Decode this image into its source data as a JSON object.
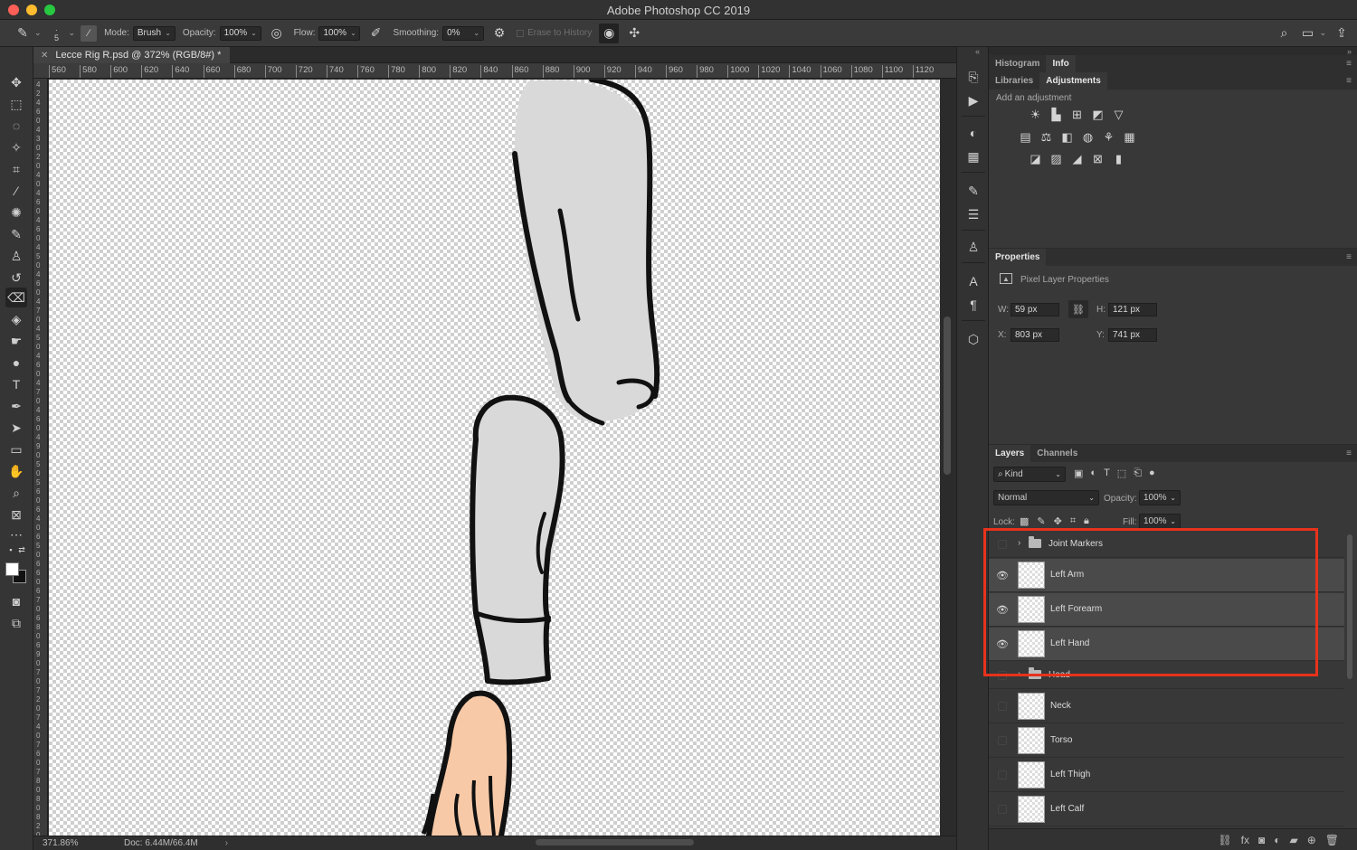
{
  "window": {
    "title": "Adobe Photoshop CC 2019"
  },
  "colors": {
    "close": "#fe5f57",
    "minimize": "#febc2e",
    "zoom": "#28c840",
    "highlight": "#e8321c",
    "sleeve": "#d9d9d9",
    "skin": "#f7c9a7"
  },
  "options": {
    "brush_size": "5",
    "mode_label": "Mode:",
    "mode_value": "Brush",
    "opacity_label": "Opacity:",
    "opacity_value": "100%",
    "flow_label": "Flow:",
    "flow_value": "100%",
    "smoothing_label": "Smoothing:",
    "smoothing_value": "0%",
    "erase_history": "Erase to History"
  },
  "document": {
    "tab_title": "Lecce Rig R.psd @ 372% (RGB/8#) *"
  },
  "ruler": {
    "h_ticks": [
      "560",
      "580",
      "600",
      "620",
      "640",
      "660",
      "680",
      "700",
      "720",
      "740",
      "760",
      "780",
      "800",
      "820",
      "840",
      "860",
      "880",
      "900",
      "920",
      "940",
      "960",
      "980",
      "1000",
      "1020",
      "1040",
      "1060",
      "1080",
      "1100",
      "1120"
    ]
  },
  "status": {
    "zoom": "371.86%",
    "doc": "Doc: 6.44M/66.4M"
  },
  "panels": {
    "histogram_tab": "Histogram",
    "info_tab": "Info",
    "libraries_tab": "Libraries",
    "adjustments_tab": "Adjustments",
    "add_adjustment": "Add an adjustment",
    "properties_tab": "Properties",
    "pixel_layer_props": "Pixel Layer Properties",
    "w_label": "W:",
    "w_value": "59 px",
    "h_label": "H:",
    "h_value": "121 px",
    "x_label": "X:",
    "x_value": "803 px",
    "y_label": "Y:",
    "y_value": "741 px"
  },
  "layers_panel": {
    "layers_tab": "Layers",
    "channels_tab": "Channels",
    "kind_label": "Kind",
    "blend_mode": "Normal",
    "opacity_label": "Opacity:",
    "opacity_value": "100%",
    "lock_label": "Lock:",
    "fill_label": "Fill:",
    "fill_value": "100%",
    "layers": [
      {
        "name": "Joint Markers",
        "type": "group",
        "visible": false,
        "selected": false
      },
      {
        "name": "Left Arm",
        "type": "pixel",
        "visible": true,
        "selected": true
      },
      {
        "name": "Left Forearm",
        "type": "pixel",
        "visible": true,
        "selected": true
      },
      {
        "name": "Left Hand",
        "type": "pixel",
        "visible": true,
        "selected": true
      },
      {
        "name": "Head",
        "type": "group",
        "visible": false,
        "selected": false
      },
      {
        "name": "Neck",
        "type": "pixel",
        "visible": false,
        "selected": false
      },
      {
        "name": "Torso",
        "type": "pixel",
        "visible": false,
        "selected": false
      },
      {
        "name": "Left Thigh",
        "type": "pixel",
        "visible": false,
        "selected": false
      },
      {
        "name": "Left Calf",
        "type": "pixel",
        "visible": false,
        "selected": false
      }
    ]
  }
}
